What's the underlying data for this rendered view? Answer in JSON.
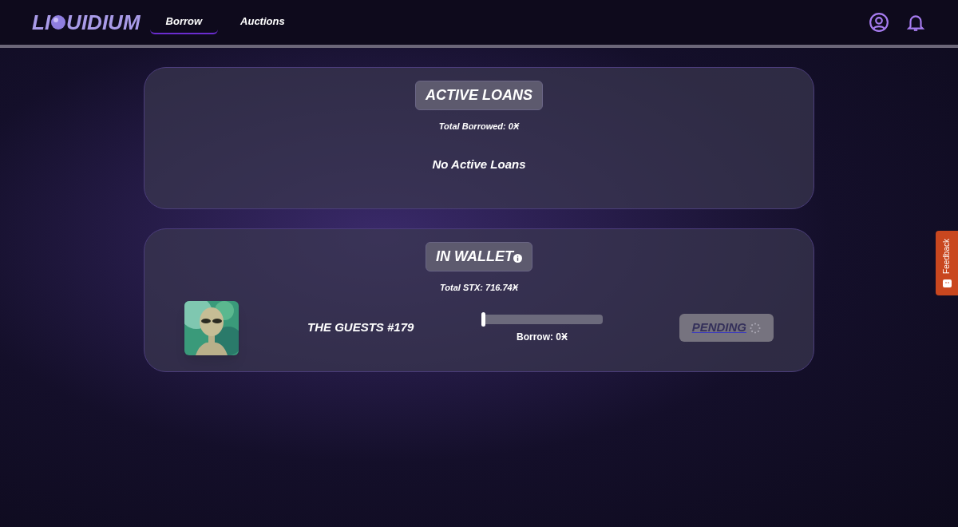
{
  "header": {
    "logo": [
      "LI",
      "UIDIUM"
    ],
    "tabs": [
      {
        "label": "Borrow",
        "selected": true
      },
      {
        "label": "Auctions",
        "selected": false
      }
    ]
  },
  "active_loans": {
    "title": "ACTIVE LOANS",
    "total": "Total Borrowed: 0Ӿ",
    "empty": "No Active Loans"
  },
  "in_wallet": {
    "title": "IN WALLET",
    "total": "Total STX: 716.74Ӿ",
    "items": [
      {
        "kind": "picture",
        "name": "THE GUESTS #179",
        "level": 0,
        "borrow": "Borrow: 0Ӿ",
        "action": {
          "label": "PENDING",
          "disabled": true
        }
      }
    ]
  },
  "feedback": {
    "label": "Feedback"
  }
}
